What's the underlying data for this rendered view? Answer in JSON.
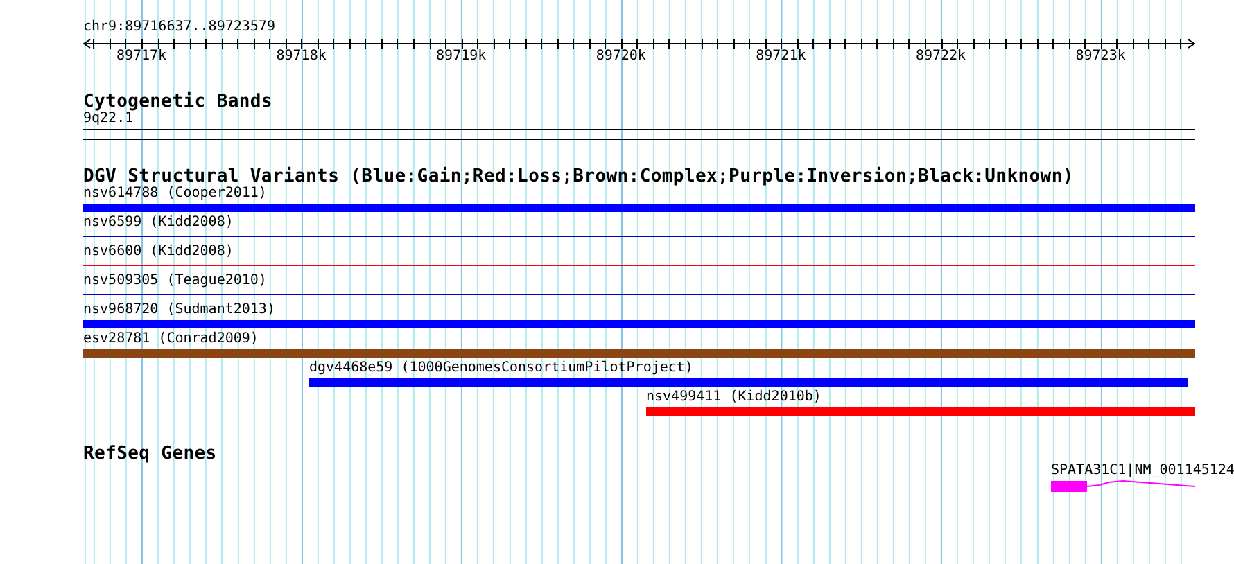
{
  "ruler": {
    "region": "chr9:89716637..89723579",
    "ticks": [
      "89717k",
      "89718k",
      "89719k",
      "89720k",
      "89721k",
      "89722k",
      "89723k"
    ]
  },
  "tracks": [
    {
      "kind": "bands",
      "title": "Cytogenetic Bands",
      "features": [
        {
          "label": "9q22.1"
        }
      ]
    },
    {
      "kind": "variants",
      "title": "DGV Structural Variants (Blue:Gain;Red:Loss;Brown:Complex;Purple:Inversion;Black:Unknown)",
      "features": [
        {
          "label": "nsv614788 (Cooper2011)",
          "kind": "bar",
          "color": "#0000ff"
        },
        {
          "label": "nsv6599 (Kidd2008)",
          "kind": "line",
          "color": "#0000c0"
        },
        {
          "label": "nsv6600 (Kidd2008)",
          "kind": "line",
          "color": "#ff0000"
        },
        {
          "label": "nsv509305 (Teague2010)",
          "kind": "line",
          "color": "#0000c0"
        },
        {
          "label": "nsv968720 (Sudmant2013)",
          "kind": "bar",
          "color": "#0000ff"
        },
        {
          "label": "esv28781 (Conrad2009)",
          "kind": "bar",
          "color": "#8b4513"
        },
        {
          "label": "dgv4468e59 (1000GenomesConsortiumPilotProject)",
          "kind": "bar",
          "color": "#0000ff"
        },
        {
          "label": "nsv499411 (Kidd2010b)",
          "kind": "bar",
          "color": "#ff0000"
        }
      ]
    },
    {
      "kind": "genes",
      "title": "RefSeq Genes",
      "features": [
        {
          "label": "SPATA31C1|NM_001145124",
          "color": "#ff00ff"
        }
      ]
    }
  ]
}
